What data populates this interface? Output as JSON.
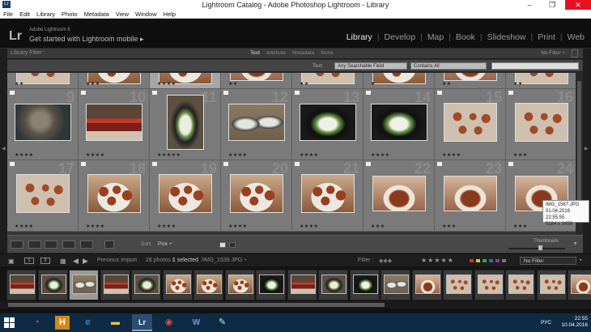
{
  "window": {
    "title": "Lightroom Catalog - Adobe Photoshop Lightroom - Library",
    "minimize": "–",
    "maximize": "❐",
    "close": "✕",
    "app_icon": "Lr"
  },
  "menu": [
    "File",
    "Edit",
    "Library",
    "Photo",
    "Metadata",
    "View",
    "Window",
    "Help"
  ],
  "identity": {
    "logo": "Lr",
    "version": "Adobe Lightroom 6",
    "mobile_prompt": "Get started with Lightroom mobile ▸"
  },
  "modules": {
    "items": [
      "Library",
      "Develop",
      "Map",
      "Book",
      "Slideshow",
      "Print",
      "Web"
    ],
    "active": "Library"
  },
  "library_filter": {
    "title": "Library Filter :",
    "tabs": [
      "Text",
      "Attribute",
      "Metadata",
      "None"
    ],
    "active_tab": "Text",
    "preset": "No Filter ÷",
    "text_label": "Text",
    "field_select": "Any Searchable Field",
    "rule_select": "Contains All",
    "search_value": ""
  },
  "grid": {
    "rows": [
      [
        {
          "num": "",
          "stars": "★★",
          "photo": "cookies"
        },
        {
          "num": "",
          "stars": "★★★",
          "photo": "plate"
        },
        {
          "num": "",
          "stars": "★★★★",
          "photo": "plate"
        },
        {
          "num": "",
          "stars": "★★",
          "photo": "platesm"
        },
        {
          "num": "",
          "stars": "★★",
          "photo": "cookies"
        },
        {
          "num": "",
          "stars": "★",
          "photo": "plate"
        },
        {
          "num": "",
          "stars": "★★",
          "photo": "platesm"
        },
        {
          "num": "",
          "stars": "★★",
          "photo": "cookies"
        }
      ],
      [
        {
          "num": "9",
          "stars": "★★★★",
          "photo": "cat"
        },
        {
          "num": "10",
          "stars": "★★★★",
          "photo": "jars"
        },
        {
          "num": "11",
          "stars": "★★★★★",
          "photo": "bowl"
        },
        {
          "num": "12",
          "stars": "★★★★",
          "photo": "bowls"
        },
        {
          "num": "13",
          "stars": "★★★★",
          "photo": "dark"
        },
        {
          "num": "14",
          "stars": "★★★★",
          "photo": "dark"
        },
        {
          "num": "15",
          "stars": "★★★★",
          "photo": "cookies"
        },
        {
          "num": "16",
          "stars": "★★★",
          "photo": "cookies"
        }
      ],
      [
        {
          "num": "17",
          "stars": "★★★★",
          "photo": "cookies"
        },
        {
          "num": "18",
          "stars": "★★★★",
          "photo": "plate"
        },
        {
          "num": "19",
          "stars": "★★★★",
          "photo": "plate"
        },
        {
          "num": "20",
          "stars": "★★★★",
          "photo": "plate"
        },
        {
          "num": "21",
          "stars": "★★★★",
          "photo": "plate"
        },
        {
          "num": "22",
          "stars": "★★★",
          "photo": "platesm"
        },
        {
          "num": "23",
          "stars": "★★★",
          "photo": "platesm"
        },
        {
          "num": "24",
          "stars": "★★★",
          "photo": "platesm"
        }
      ]
    ],
    "selected_index": "0.2"
  },
  "tooltip": {
    "filename": "IMG_1567.JPG",
    "datetime": "01.04.2016 22:55:55",
    "dimensions": "5184 x 3456"
  },
  "toolbar": {
    "sort_label": "Sort:",
    "sort_value": "Pick ÷",
    "thumbnails_label": "Thumbnails"
  },
  "filmstrip_bar": {
    "page1": "1",
    "page2": "2",
    "source": "Previous Import",
    "count": "28 photos /",
    "selected": "1 selected",
    "path": "/IMG_1539.JPG ÷",
    "filter_label": "Filter :",
    "filter_stars": "★★★★★",
    "no_filter": "No Filter"
  },
  "filmstrip": [
    {
      "photo": "jars",
      "stars": ""
    },
    {
      "photo": "bowl",
      "stars": ""
    },
    {
      "photo": "bowls",
      "stars": "★★★★"
    },
    {
      "photo": "jars",
      "stars": ""
    },
    {
      "photo": "bowl",
      "stars": ""
    },
    {
      "photo": "plate",
      "stars": ""
    },
    {
      "photo": "plate",
      "stars": ""
    },
    {
      "photo": "plate",
      "stars": ""
    },
    {
      "photo": "dark",
      "stars": ""
    },
    {
      "photo": "jars",
      "stars": ""
    },
    {
      "photo": "bowl",
      "stars": ""
    },
    {
      "photo": "dark",
      "stars": ""
    },
    {
      "photo": "bowls",
      "stars": ""
    },
    {
      "photo": "platesm",
      "stars": ""
    },
    {
      "photo": "cookies",
      "stars": ""
    },
    {
      "photo": "cookies",
      "stars": ""
    },
    {
      "photo": "cookies",
      "stars": ""
    },
    {
      "photo": "cookies",
      "stars": ""
    },
    {
      "photo": "platesm",
      "stars": ""
    }
  ],
  "taskbar": {
    "apps": [
      "Chrome-like",
      "H",
      "IE",
      "Files",
      "Lr",
      "Chrome",
      "Word",
      "Paint"
    ],
    "active_app": "Lr",
    "lang": "РУС",
    "time": "22:55",
    "date": "10.04.2016"
  },
  "colors": {
    "accent_active": "#e8e8e8",
    "panel": "#3a3a3a",
    "grid_cell": "#7a7a7a",
    "taskbar": "#0f2a44"
  }
}
